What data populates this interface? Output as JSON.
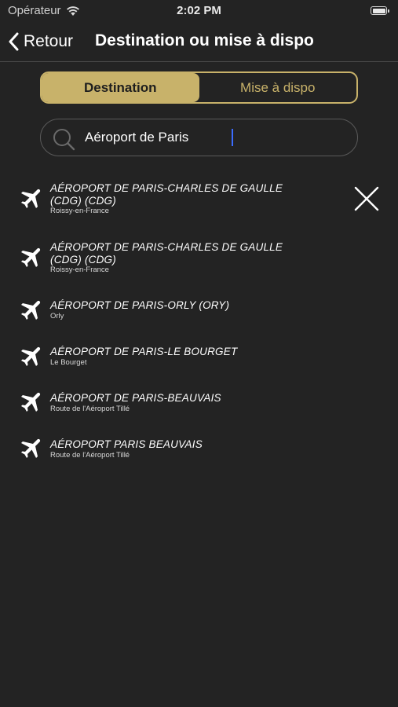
{
  "status_bar": {
    "carrier": "Opérateur",
    "time": "2:02 PM"
  },
  "nav": {
    "back_label": "Retour",
    "title": "Destination ou mise à dispo"
  },
  "segments": {
    "destination_label": "Destination",
    "mise_label": "Mise à dispo",
    "selected": "Destination"
  },
  "search": {
    "value": "Aéroport de Paris"
  },
  "results": [
    {
      "name_line1": "AÉROPORT DE PARIS-CHARLES DE GAULLE",
      "name_line2": "(CDG) (CDG)",
      "sub": "Roissy-en-France"
    },
    {
      "name_line1": "AÉROPORT DE PARIS-CHARLES DE GAULLE",
      "name_line2": "(CDG) (CDG)",
      "sub": "Roissy-en-France"
    },
    {
      "name_line1": "AÉROPORT DE PARIS-ORLY (ORY)",
      "sub": "Orly"
    },
    {
      "name_line1": "AÉROPORT DE PARIS-LE BOURGET",
      "sub": "Le Bourget"
    },
    {
      "name_line1": "AÉROPORT DE PARIS-BEAUVAIS",
      "sub": "Route de l'Aéroport Tillé"
    },
    {
      "name_line1": "AÉROPORT PARIS BEAUVAIS",
      "sub": "Route de l'Aéroport Tillé"
    }
  ],
  "colors": {
    "background": "#232323",
    "accent_gold": "#c8b26a",
    "caret": "#3b6cff"
  },
  "icons": [
    "wifi-icon",
    "battery-icon",
    "back-chevron-icon",
    "search-icon",
    "airplane-icon",
    "close-icon"
  ]
}
